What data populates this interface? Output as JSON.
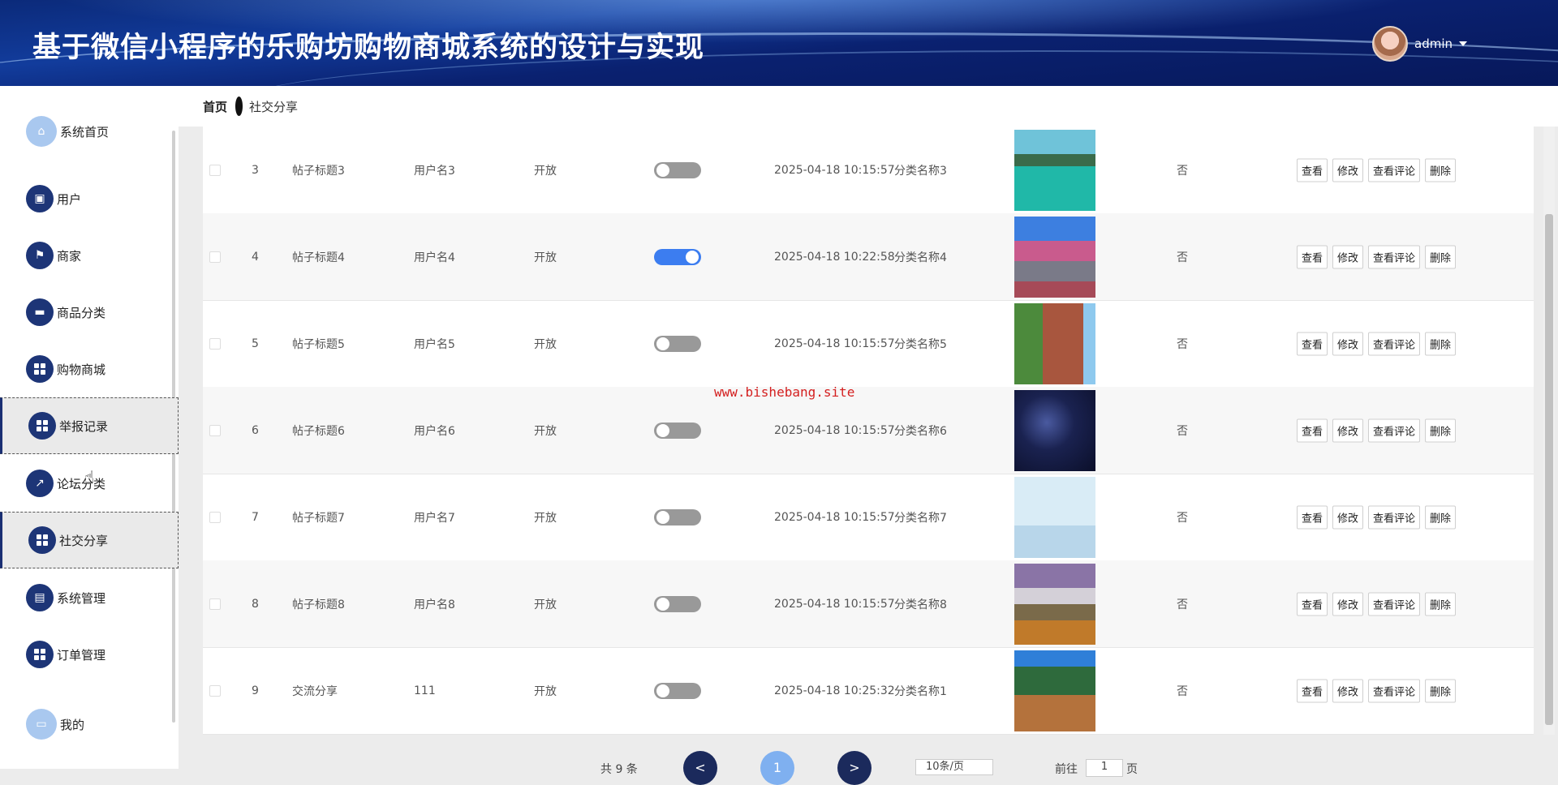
{
  "header": {
    "title": "基于微信小程序的乐购坊购物商城系统的设计与实现",
    "username": "admin"
  },
  "breadcrumb": {
    "home": "首页",
    "current": "社交分享"
  },
  "sidebar": {
    "items": [
      {
        "label": "系统首页",
        "icon": "home-icon",
        "active": false
      },
      {
        "label": "用户",
        "icon": "briefcase-icon",
        "active": false
      },
      {
        "label": "商家",
        "icon": "flag-icon",
        "active": false
      },
      {
        "label": "商品分类",
        "icon": "card-icon",
        "active": false
      },
      {
        "label": "购物商城",
        "icon": "grid-icon",
        "active": false
      },
      {
        "label": "举报记录",
        "icon": "grid-icon",
        "active": true
      },
      {
        "label": "论坛分类",
        "icon": "chart-icon",
        "active": false
      },
      {
        "label": "社交分享",
        "icon": "grid-icon",
        "active": true
      },
      {
        "label": "系统管理",
        "icon": "clipboard-icon",
        "active": false
      },
      {
        "label": "订单管理",
        "icon": "grid-icon",
        "active": false
      },
      {
        "label": "我的",
        "icon": "wallet-icon",
        "active": false
      }
    ]
  },
  "table": {
    "rows": [
      {
        "index": "3",
        "title": "帖子标题3",
        "user": "用户名3",
        "status": "开放",
        "toggle": false,
        "time": "2025-04-18 10:15:57",
        "category": "分类名称3",
        "image": "resort-photo",
        "flag": "否"
      },
      {
        "index": "4",
        "title": "帖子标题4",
        "user": "用户名4",
        "status": "开放",
        "toggle": true,
        "time": "2025-04-18 10:22:58",
        "category": "分类名称4",
        "image": "blossom-photo",
        "flag": "否"
      },
      {
        "index": "5",
        "title": "帖子标题5",
        "user": "用户名5",
        "status": "开放",
        "toggle": false,
        "time": "2025-04-18 10:15:57",
        "category": "分类名称5",
        "image": "building-photo",
        "flag": "否"
      },
      {
        "index": "6",
        "title": "帖子标题6",
        "user": "用户名6",
        "status": "开放",
        "toggle": false,
        "time": "2025-04-18 10:15:57",
        "category": "分类名称6",
        "image": "nightsky-photo",
        "flag": "否"
      },
      {
        "index": "7",
        "title": "帖子标题7",
        "user": "用户名7",
        "status": "开放",
        "toggle": false,
        "time": "2025-04-18 10:15:57",
        "category": "分类名称7",
        "image": "hockey-photo",
        "flag": "否"
      },
      {
        "index": "8",
        "title": "帖子标题8",
        "user": "用户名8",
        "status": "开放",
        "toggle": false,
        "time": "2025-04-18 10:15:57",
        "category": "分类名称8",
        "image": "mountain-photo",
        "flag": "否"
      },
      {
        "index": "9",
        "title": "交流分享",
        "user": "111",
        "status": "开放",
        "toggle": false,
        "time": "2025-04-18 10:25:32",
        "category": "分类名称1",
        "image": "storefront-photo",
        "flag": "否"
      }
    ],
    "actions": {
      "view": "查看",
      "edit": "修改",
      "comments": "查看评论",
      "delete": "删除"
    }
  },
  "watermark": "www.bishebang.site",
  "pagination": {
    "total_label": "共 9 条",
    "prev": "<",
    "current_page": "1",
    "next": ">",
    "page_size": "10条/页",
    "goto_prefix": "前往",
    "goto_value": "1",
    "goto_suffix": "页"
  },
  "colors": {
    "primary": "#1d3577",
    "toggle_on": "#3c7df0",
    "watermark": "#d42020"
  }
}
